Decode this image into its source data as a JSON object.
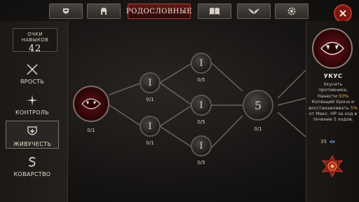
{
  "tabs": [
    {
      "icon": "helmet-shield-icon"
    },
    {
      "icon": "spartan-helmet-icon"
    },
    {
      "label": "РОДОСЛОВНЫЕ",
      "active": true
    },
    {
      "icon": "open-book-icon"
    },
    {
      "icon": "wings-icon"
    },
    {
      "icon": "gear-icon"
    }
  ],
  "skill_points": {
    "label": "ОЧКИ НАВЫКОВ",
    "value": "42"
  },
  "categories": [
    {
      "label": "ЯРОСТЬ",
      "icon": "crossed-swords-icon"
    },
    {
      "label": "КОНТРОЛЬ",
      "icon": "star-burst-icon"
    },
    {
      "label": "ЖИВУЧЕСТЬ",
      "icon": "shield-cross-icon",
      "selected": true
    },
    {
      "label": "КОВАРСТВО",
      "icon": "serpent-icon"
    }
  ],
  "tree": {
    "root": {
      "count": "0/1"
    },
    "tier2a": {
      "symbol": "I",
      "count": "0/1"
    },
    "tier2b": {
      "symbol": "I",
      "count": "0/1"
    },
    "tier3a": {
      "symbol": "I",
      "count": "0/5"
    },
    "tier3b": {
      "symbol": "I",
      "count": "0/5"
    },
    "tier3c": {
      "symbol": "I",
      "count": "0/5"
    },
    "tier3d": {
      "symbol": "I",
      "count": "0/5"
    },
    "tier4": {
      "symbol": "5",
      "count": "0/1"
    }
  },
  "detail": {
    "name": "УКУС",
    "desc_pre": "Укусить противника. Нанести ",
    "desc_hl1": "50%",
    "desc_mid": " Колющий Урона и восстанавливать ",
    "desc_hl2": "5%",
    "desc_post": " от Макс. HP за ход в течение 5 ходов.",
    "cost": "35"
  },
  "colors": {
    "accent": "#b53a2c",
    "highlight": "#e0b24a"
  }
}
